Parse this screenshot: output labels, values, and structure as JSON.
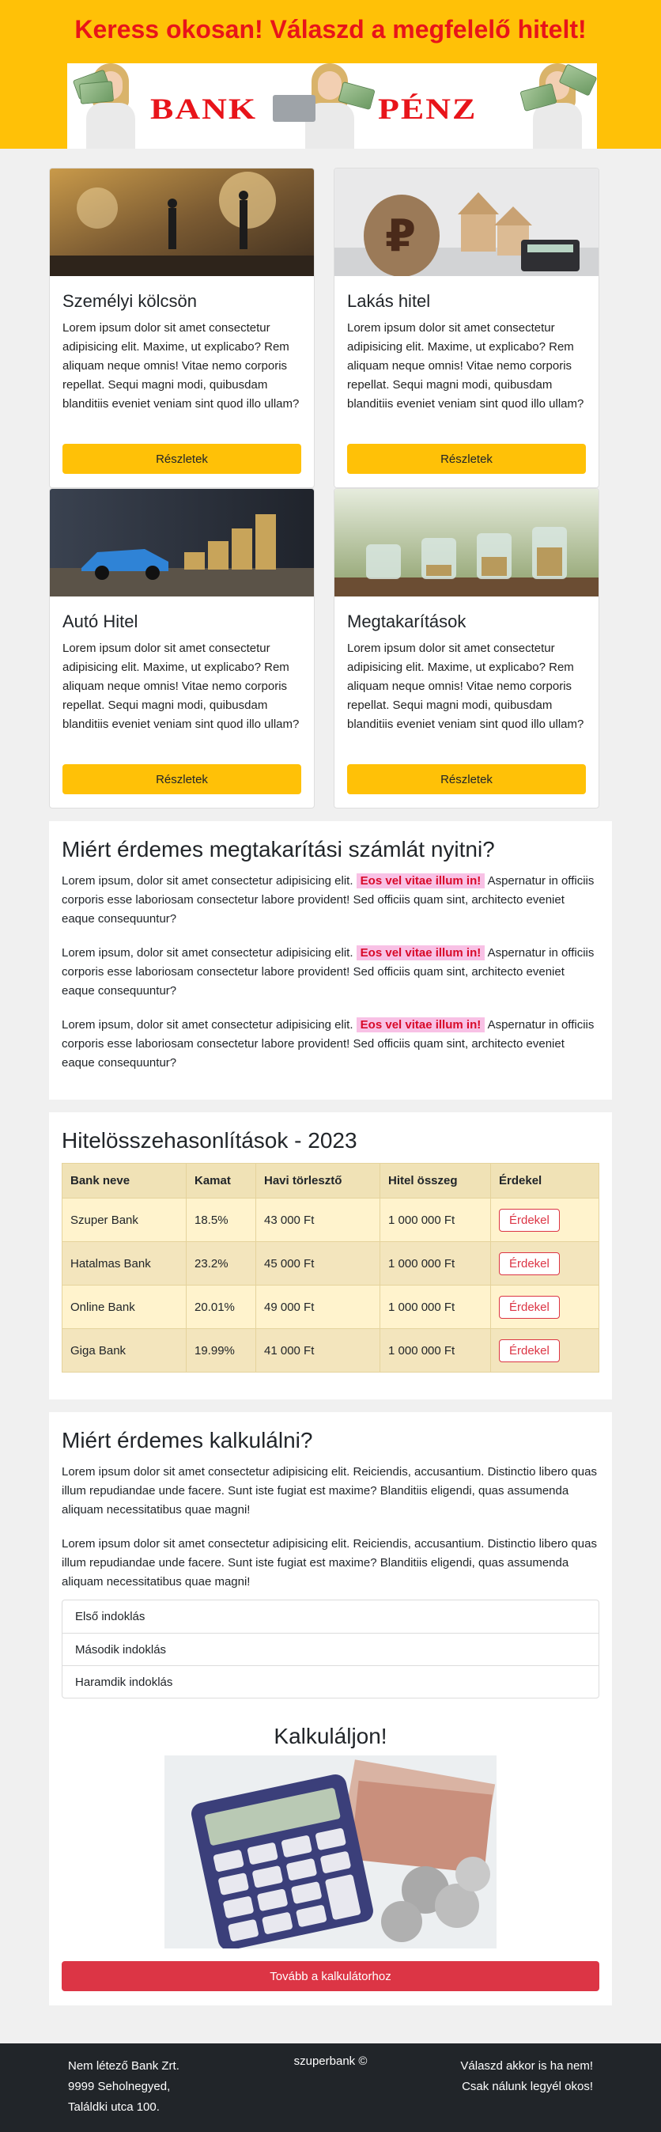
{
  "header": {
    "title": "Keress okosan! Válaszd a megfelelő hitelt!",
    "bank_word": "BANK",
    "penz_word": "PÉNZ"
  },
  "cards": [
    {
      "title": "Személyi kölcsön",
      "text": "Lorem ipsum dolor sit amet consectetur adipisicing elit. Maxime, ut explicabo? Rem aliquam neque omnis! Vitae nemo corporis repellat. Sequi magni modi, quibusdam blanditiis eveniet veniam sint quod illo ullam?",
      "button": "Részletek"
    },
    {
      "title": "Lakás hitel",
      "text": "Lorem ipsum dolor sit amet consectetur adipisicing elit. Maxime, ut explicabo? Rem aliquam neque omnis! Vitae nemo corporis repellat. Sequi magni modi, quibusdam blanditiis eveniet veniam sint quod illo ullam?",
      "button": "Részletek"
    },
    {
      "title": "Autó Hitel",
      "text": "Lorem ipsum dolor sit amet consectetur adipisicing elit. Maxime, ut explicabo? Rem aliquam neque omnis! Vitae nemo corporis repellat. Sequi magni modi, quibusdam blanditiis eveniet veniam sint quod illo ullam?",
      "button": "Részletek"
    },
    {
      "title": "Megtakarítások",
      "text": "Lorem ipsum dolor sit amet consectetur adipisicing elit. Maxime, ut explicabo? Rem aliquam neque omnis! Vitae nemo corporis repellat. Sequi magni modi, quibusdam blanditiis eveniet veniam sint quod illo ullam?",
      "button": "Részletek"
    }
  ],
  "savings": {
    "title": "Miért érdemes megtakarítási számlát nyitni?",
    "paragraphs": [
      {
        "before": "Lorem ipsum, dolor sit amet consectetur adipisicing elit. ",
        "mark": "Eos vel vitae illum in!",
        "after": " Aspernatur in officiis corporis esse laboriosam consectetur labore provident! Sed officiis quam sint, architecto eveniet eaque consequuntur?"
      },
      {
        "before": "Lorem ipsum, dolor sit amet consectetur adipisicing elit. ",
        "mark": "Eos vel vitae illum in!",
        "after": " Aspernatur in officiis corporis esse laboriosam consectetur labore provident! Sed officiis quam sint, architecto eveniet eaque consequuntur?"
      },
      {
        "before": "Lorem ipsum, dolor sit amet consectetur adipisicing elit. ",
        "mark": "Eos vel vitae illum in!",
        "after": " Aspernatur in officiis corporis esse laboriosam consectetur labore provident! Sed officiis quam sint, architecto eveniet eaque consequuntur?"
      }
    ]
  },
  "comparison": {
    "title": "Hitelösszehasonlítások - 2023",
    "headers": [
      "Bank neve",
      "Kamat",
      "Havi törlesztő",
      "Hitel összeg",
      "Érdekel"
    ],
    "rows": [
      {
        "bank": "Szuper Bank",
        "rate": "18.5%",
        "monthly": "43 000 Ft",
        "amount": "1 000 000 Ft",
        "button": "Érdekel"
      },
      {
        "bank": "Hatalmas Bank",
        "rate": "23.2%",
        "monthly": "45 000 Ft",
        "amount": "1 000 000 Ft",
        "button": "Érdekel"
      },
      {
        "bank": "Online Bank",
        "rate": "20.01%",
        "monthly": "49 000 Ft",
        "amount": "1 000 000 Ft",
        "button": "Érdekel"
      },
      {
        "bank": "Giga Bank",
        "rate": "19.99%",
        "monthly": "41 000 Ft",
        "amount": "1 000 000 Ft",
        "button": "Érdekel"
      }
    ]
  },
  "calc_section": {
    "title": "Miért érdemes kalkulálni?",
    "paragraphs": [
      "Lorem ipsum dolor sit amet consectetur adipisicing elit. Reiciendis, accusantium. Distinctio libero quas illum repudiandae unde facere. Sunt iste fugiat est maxime? Blanditiis eligendi, quas assumenda aliquam necessitatibus quae magni!",
      "Lorem ipsum dolor sit amet consectetur adipisicing elit. Reiciendis, accusantium. Distinctio libero quas illum repudiandae unde facere. Sunt iste fugiat est maxime? Blanditiis eligendi, quas assumenda aliquam necessitatibus quae magni!"
    ],
    "list": [
      "Első indoklás",
      "Második indoklás",
      "Haramdik indoklás"
    ],
    "calc_title": "Kalkuláljon!",
    "button": "Tovább a kalkulátorhoz"
  },
  "footer": {
    "left": [
      "Nem létező Bank Zrt.",
      "9999 Seholnegyed,",
      "Találdki utca 100."
    ],
    "middle": "szuperbank ©",
    "right": [
      "Válaszd akkor is ha nem!",
      "Csak nálunk legyél okos!"
    ]
  },
  "colors": {
    "accent_yellow": "#ffc107",
    "title_red": "#e8141a",
    "button_red": "#dc3545",
    "mark_bg": "#f8c1e5",
    "footer_bg": "#212529"
  }
}
